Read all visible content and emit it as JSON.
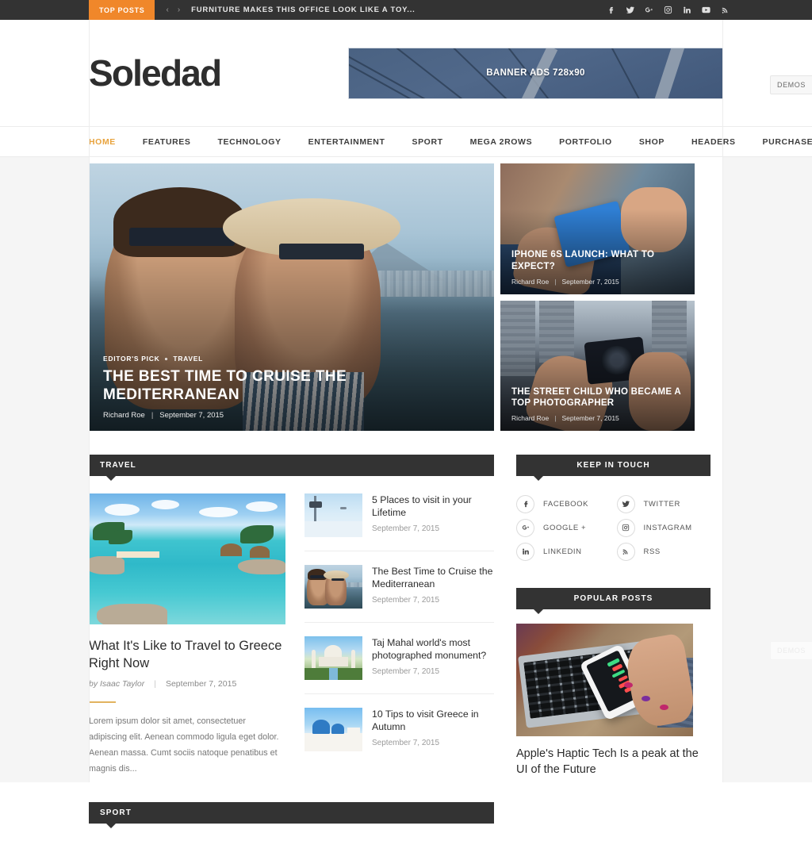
{
  "topbar": {
    "badge": "TOP POSTS",
    "prev": "‹",
    "next": "›",
    "headline": "FURNITURE MAKES THIS OFFICE LOOK LIKE A TOY...",
    "social": [
      {
        "name": "facebook-icon",
        "label": "Facebook"
      },
      {
        "name": "twitter-icon",
        "label": "Twitter"
      },
      {
        "name": "google-plus-icon",
        "label": "Google Plus"
      },
      {
        "name": "instagram-icon",
        "label": "Instagram"
      },
      {
        "name": "linkedin-icon",
        "label": "LinkedIn"
      },
      {
        "name": "youtube-icon",
        "label": "YouTube"
      },
      {
        "name": "rss-icon",
        "label": "RSS"
      }
    ]
  },
  "header": {
    "logo": "Soledad",
    "banner_label": "BANNER ADS 728x90"
  },
  "nav": {
    "items": [
      {
        "label": "HOME",
        "active": true
      },
      {
        "label": "FEATURES",
        "active": false
      },
      {
        "label": "TECHNOLOGY",
        "active": false
      },
      {
        "label": "ENTERTAINMENT",
        "active": false
      },
      {
        "label": "SPORT",
        "active": false
      },
      {
        "label": "MEGA 2ROWS",
        "active": false
      },
      {
        "label": "PORTFOLIO",
        "active": false
      },
      {
        "label": "SHOP",
        "active": false
      },
      {
        "label": "HEADERS",
        "active": false
      },
      {
        "label": "PURCHASE",
        "active": false
      }
    ],
    "search_icon": "search-icon"
  },
  "hero": {
    "main": {
      "category_primary": "EDITOR'S PICK",
      "category_secondary": "TRAVEL",
      "title": "THE BEST TIME TO CRUISE THE MEDITERRANEAN",
      "author": "Richard Roe",
      "date": "September 7, 2015"
    },
    "cards": [
      {
        "title": "IPHONE 6S LAUNCH: WHAT TO EXPECT?",
        "author": "Richard Roe",
        "date": "September 7, 2015"
      },
      {
        "title": "THE STREET CHILD WHO BECAME A TOP PHOTOGRAPHER",
        "author": "Richard Roe",
        "date": "September 7, 2015"
      }
    ]
  },
  "travel_section": {
    "heading": "TRAVEL",
    "featured": {
      "title": "What It's Like to Travel to Greece Right Now",
      "author": "by Isaac Taylor",
      "date": "September 7, 2015",
      "excerpt": "Lorem ipsum dolor sit amet, consectetuer adipiscing elit. Aenean commodo ligula eget dolor. Aenean massa. Cumt sociis natoque penatibus et magnis dis..."
    },
    "list": [
      {
        "title": "5 Places to visit in your Lifetime",
        "date": "September 7, 2015"
      },
      {
        "title": "The Best Time to Cruise the Mediterranean",
        "date": "September 7, 2015"
      },
      {
        "title": "Taj Mahal world's most photographed monument?",
        "date": "September 7, 2015"
      },
      {
        "title": "10 Tips to visit Greece in Autumn",
        "date": "September 7, 2015"
      }
    ]
  },
  "sport_section": {
    "heading": "SPORT"
  },
  "sidebar": {
    "keep_in_touch": {
      "heading": "KEEP IN TOUCH",
      "items": [
        {
          "icon": "facebook-icon",
          "label": "FACEBOOK"
        },
        {
          "icon": "twitter-icon",
          "label": "TWITTER"
        },
        {
          "icon": "google-plus-icon",
          "label": "GOOGLE +"
        },
        {
          "icon": "instagram-icon",
          "label": "INSTAGRAM"
        },
        {
          "icon": "linkedin-icon",
          "label": "LINKEDIN"
        },
        {
          "icon": "rss-icon",
          "label": "RSS"
        }
      ]
    },
    "popular_posts": {
      "heading": "POPULAR POSTS",
      "items": [
        {
          "title": "Apple's Haptic Tech Is a peak at the UI of the Future"
        }
      ]
    }
  },
  "demos_tabs": [
    {
      "label": "DEMOS"
    },
    {
      "label": "DEMOS"
    }
  ],
  "colors": {
    "accent_orange": "#f0872a",
    "nav_active": "#e8a33d",
    "dark_bar": "#333333",
    "rule_gold": "#e2b35f"
  }
}
